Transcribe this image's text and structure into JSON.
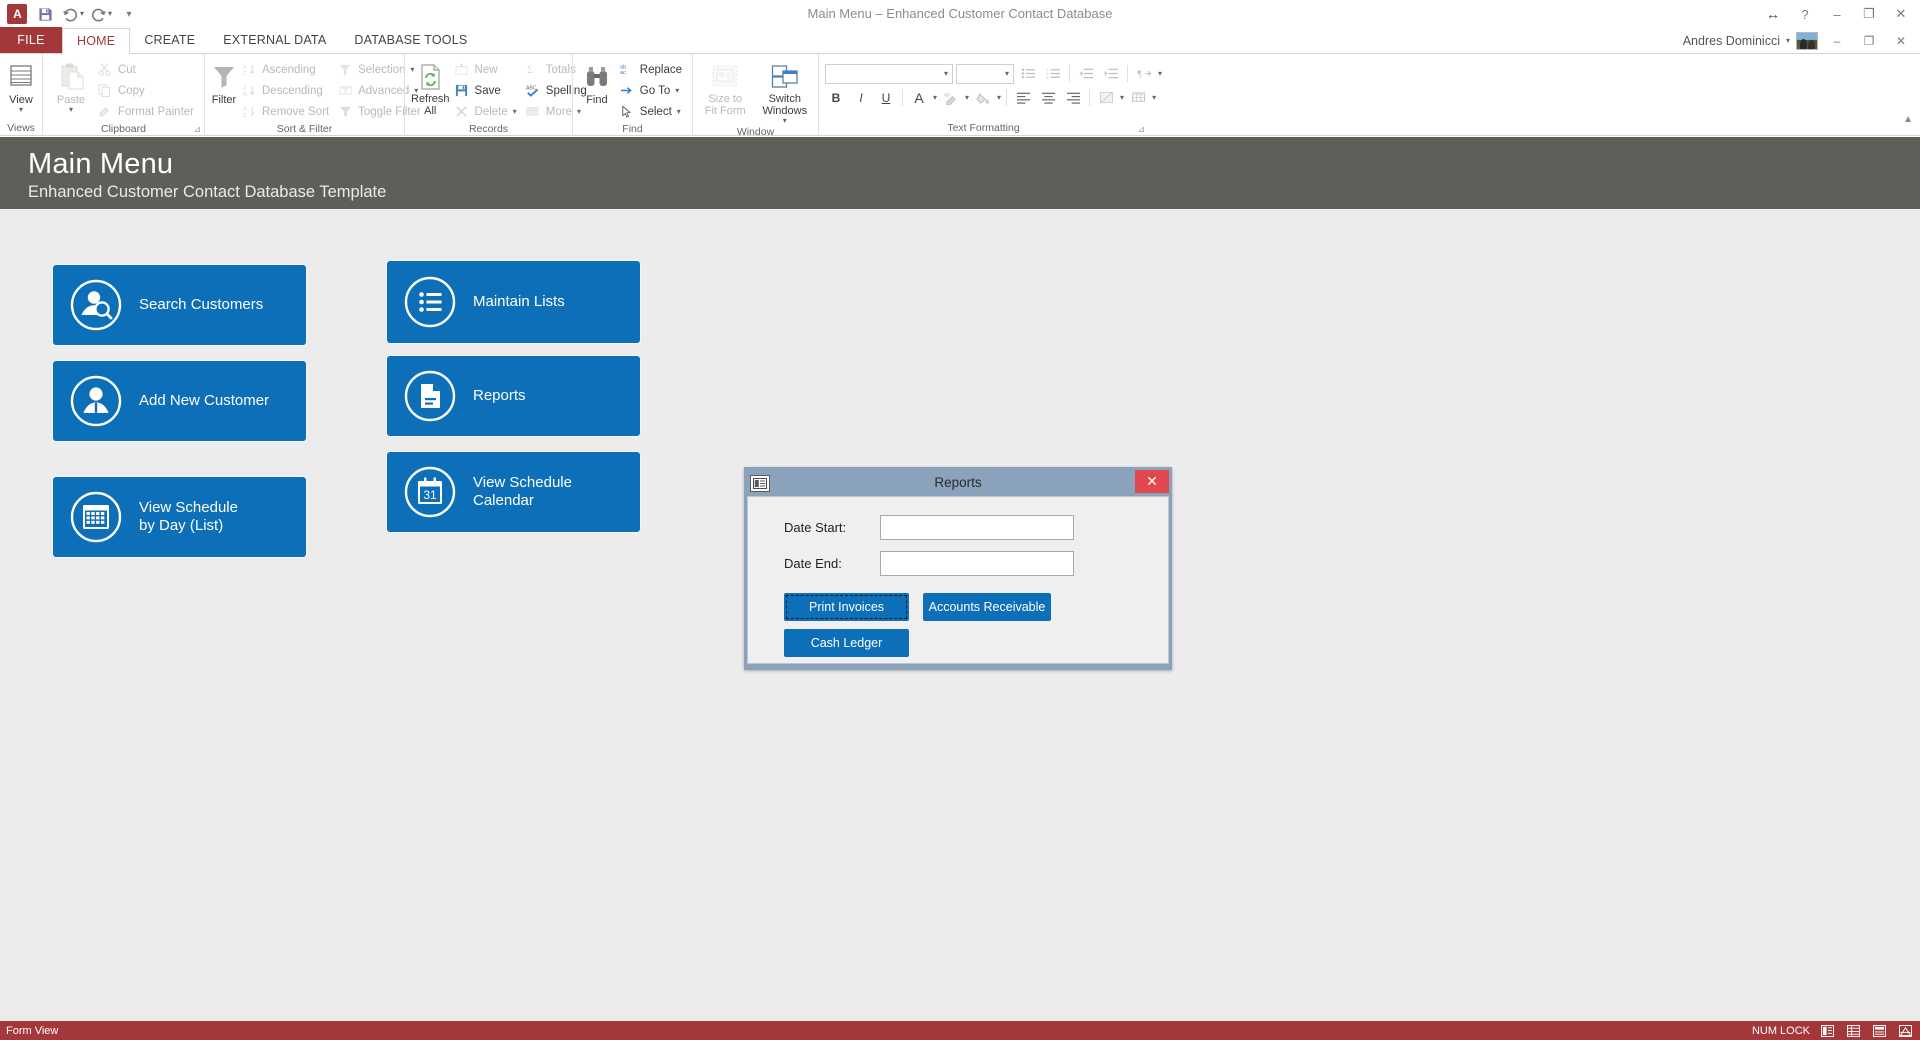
{
  "window": {
    "title": "Main Menu – Enhanced Customer Contact Database",
    "user_name": "Andres Dominicci",
    "qat": [
      {
        "name": "access-logo",
        "label": "A"
      },
      {
        "name": "save-icon",
        "label": "Save"
      },
      {
        "name": "undo-icon",
        "label": "Undo"
      },
      {
        "name": "redo-icon",
        "label": "Redo"
      },
      {
        "name": "customize-qat-icon",
        "label": "Customize Quick Access Toolbar"
      }
    ],
    "controls": {
      "restore_arrow": "↔",
      "help": "?",
      "minimize": "–",
      "restore": "❐",
      "close": "✕"
    }
  },
  "ribbon": {
    "file_tab": "FILE",
    "tabs": [
      {
        "label": "HOME",
        "active": true
      },
      {
        "label": "CREATE",
        "active": false
      },
      {
        "label": "EXTERNAL DATA",
        "active": false
      },
      {
        "label": "DATABASE TOOLS",
        "active": false
      }
    ],
    "groups": {
      "views": {
        "label": "Views",
        "view_button": "View"
      },
      "clipboard": {
        "label": "Clipboard",
        "paste": "Paste",
        "cut": "Cut",
        "copy": "Copy",
        "format_painter": "Format Painter"
      },
      "sort_filter": {
        "label": "Sort & Filter",
        "filter": "Filter",
        "ascending": "Ascending",
        "descending": "Descending",
        "remove_sort": "Remove Sort",
        "selection": "Selection",
        "advanced": "Advanced",
        "toggle_filter": "Toggle Filter"
      },
      "records": {
        "label": "Records",
        "refresh_all_line1": "Refresh",
        "refresh_all_line2": "All",
        "new": "New",
        "save": "Save",
        "delete": "Delete",
        "totals": "Totals",
        "spelling": "Spelling",
        "more": "More"
      },
      "find": {
        "label": "Find",
        "find": "Find",
        "replace": "Replace",
        "go_to": "Go To",
        "select": "Select"
      },
      "window": {
        "label": "Window",
        "size_to_fit_line1": "Size to",
        "size_to_fit_line2": "Fit Form",
        "switch_windows_line1": "Switch",
        "switch_windows_line2": "Windows"
      },
      "text_formatting": {
        "label": "Text Formatting",
        "bold": "B",
        "italic": "I",
        "underline": "U",
        "font_color": "A",
        "highlight": "ab",
        "fill_color": "Fill",
        "align_left": "Align Left",
        "align_center": "Center",
        "align_right": "Align Right",
        "bullets": "Bullets",
        "numbering": "Numbering",
        "decrease_indent": "Decrease Indent",
        "increase_indent": "Increase Indent",
        "text_direction": "Text Direction",
        "formatting": "Conditional Formatting",
        "gridlines": "Gridlines"
      }
    }
  },
  "form_header": {
    "title": "Main Menu",
    "subtitle": "Enhanced Customer Contact Database Template"
  },
  "nav_buttons": [
    {
      "label": "Search Customers",
      "icon": "user-search-icon",
      "label2": ""
    },
    {
      "label": "Add New Customer",
      "icon": "user-add-icon",
      "label2": ""
    },
    {
      "label": "View Schedule",
      "label2": "by Day (List)",
      "icon": "calendar-grid-icon"
    },
    {
      "label": "Maintain Lists",
      "label2": "",
      "icon": "list-icon"
    },
    {
      "label": "Reports",
      "label2": "",
      "icon": "document-icon"
    },
    {
      "label": "View Schedule",
      "label2": "Calendar",
      "icon": "calendar-31-icon"
    }
  ],
  "dialog": {
    "title": "Reports",
    "close": "✕",
    "fields": [
      {
        "label": "Date Start:",
        "value": "",
        "placeholder": ""
      },
      {
        "label": "Date End:",
        "value": "",
        "placeholder": ""
      }
    ],
    "buttons": [
      {
        "label": "Print Invoices",
        "focused": true
      },
      {
        "label": "Accounts Receivable",
        "focused": false
      },
      {
        "label": "Cash Ledger",
        "focused": false
      }
    ]
  },
  "statusbar": {
    "view_mode": "Form View",
    "num_lock": "NUM LOCK",
    "view_toggles": [
      "form-view-icon",
      "datasheet-view-icon",
      "layout-view-icon",
      "design-view-icon"
    ]
  },
  "colors": {
    "accent_blue": "#0d6fb8",
    "access_red": "#a4373a",
    "header_gray": "#5f5f59",
    "canvas": "#ececec",
    "dialog_chrome": "#8ba2bd",
    "close_red": "#e0484c"
  }
}
